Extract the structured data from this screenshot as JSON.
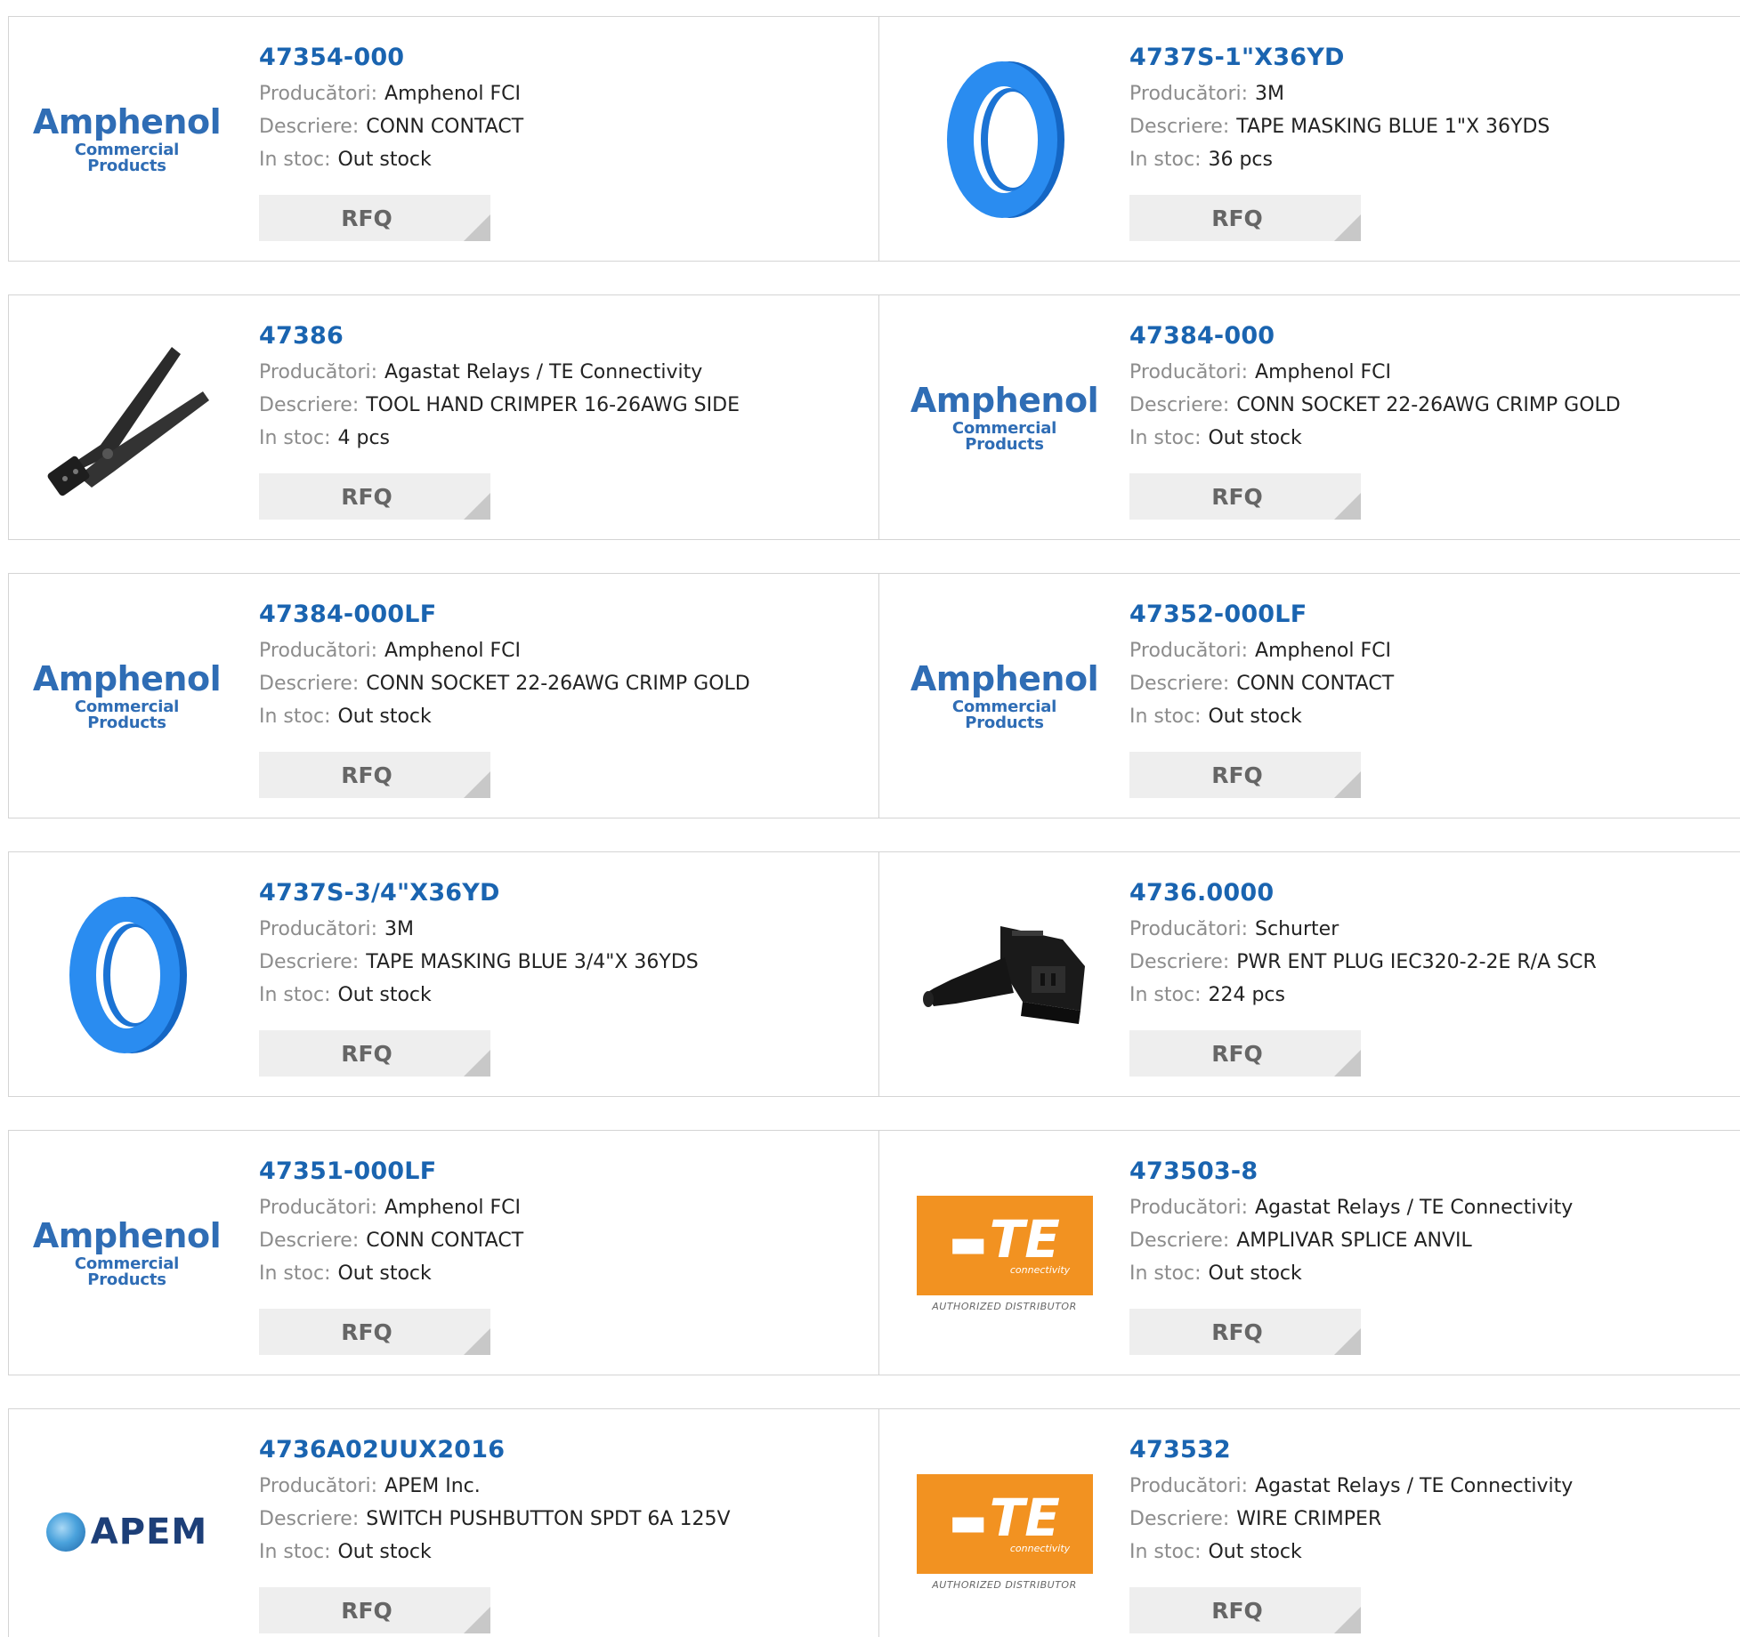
{
  "labels": {
    "manufacturer": "Producători:",
    "description": "Descriere:",
    "stock": "In stoc:",
    "rfq": "RFQ"
  },
  "products": [
    {
      "part": "47354-000",
      "manufacturer": "Amphenol FCI",
      "description": "CONN CONTACT",
      "stock": "Out stock",
      "image": "amphenol-logo"
    },
    {
      "part": "4737S-1\"X36YD",
      "manufacturer": "3M",
      "description": "TAPE MASKING BLUE 1\"X 36YDS",
      "stock": "36 pcs",
      "image": "blue-tape-roll"
    },
    {
      "part": "47386",
      "manufacturer": "Agastat Relays / TE Connectivity",
      "description": "TOOL HAND CRIMPER 16-26AWG SIDE",
      "stock": "4 pcs",
      "image": "hand-crimper"
    },
    {
      "part": "47384-000",
      "manufacturer": "Amphenol FCI",
      "description": "CONN SOCKET 22-26AWG CRIMP GOLD",
      "stock": "Out stock",
      "image": "amphenol-logo"
    },
    {
      "part": "47384-000LF",
      "manufacturer": "Amphenol FCI",
      "description": "CONN SOCKET 22-26AWG CRIMP GOLD",
      "stock": "Out stock",
      "image": "amphenol-logo"
    },
    {
      "part": "47352-000LF",
      "manufacturer": "Amphenol FCI",
      "description": "CONN CONTACT",
      "stock": "Out stock",
      "image": "amphenol-logo"
    },
    {
      "part": "4737S-3/4\"X36YD",
      "manufacturer": "3M",
      "description": "TAPE MASKING BLUE 3/4\"X 36YDS",
      "stock": "Out stock",
      "image": "blue-tape-roll"
    },
    {
      "part": "4736.0000",
      "manufacturer": "Schurter",
      "description": "PWR ENT PLUG IEC320-2-2E R/A SCR",
      "stock": "224 pcs",
      "image": "power-plug"
    },
    {
      "part": "47351-000LF",
      "manufacturer": "Amphenol FCI",
      "description": "CONN CONTACT",
      "stock": "Out stock",
      "image": "amphenol-logo"
    },
    {
      "part": "473503-8",
      "manufacturer": "Agastat Relays / TE Connectivity",
      "description": "AMPLIVAR SPLICE ANVIL",
      "stock": "Out stock",
      "image": "te-logo"
    },
    {
      "part": "4736A02UUX2016",
      "manufacturer": "APEM Inc.",
      "description": "SWITCH PUSHBUTTON SPDT 6A 125V",
      "stock": "Out stock",
      "image": "apem-logo"
    },
    {
      "part": "473532",
      "manufacturer": "Agastat Relays / TE Connectivity",
      "description": "WIRE CRIMPER",
      "stock": "Out stock",
      "image": "te-logo"
    }
  ],
  "logos": {
    "amphenol": {
      "name": "Amphenol",
      "tagline": "Commercial Products"
    },
    "apem": {
      "name": "APEM"
    },
    "te": {
      "name": "TE",
      "sub": "connectivity",
      "badge": "AUTHORIZED DISTRIBUTOR"
    }
  },
  "colors": {
    "part_link": "#1a64b0",
    "label": "#8c8c8c",
    "rfq_bg": "#eeeeee",
    "te_orange": "#f29221",
    "tape_blue": "#1e7fdc"
  }
}
